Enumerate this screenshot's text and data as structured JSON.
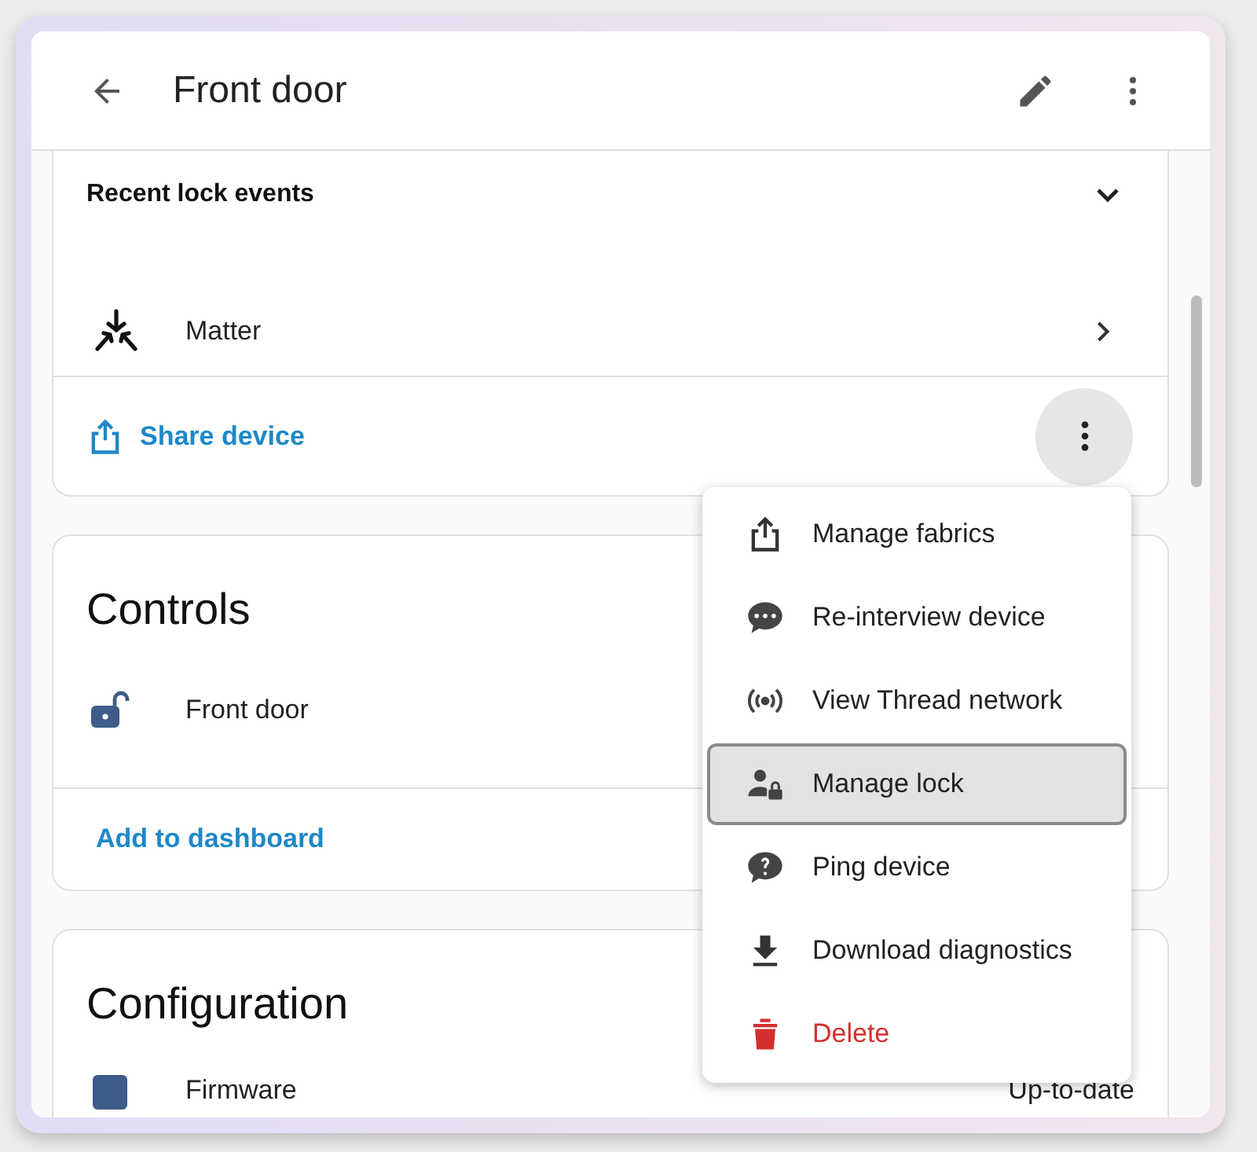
{
  "header": {
    "title": "Front door"
  },
  "info_card": {
    "section_title": "Recent lock events",
    "integration": "Matter",
    "share_link": "Share device"
  },
  "controls_card": {
    "title": "Controls",
    "entity": "Front door",
    "link": "Add to dashboard"
  },
  "configuration_card": {
    "title": "Configuration",
    "row_label": "Firmware",
    "row_value": "Up-to-date"
  },
  "menu": [
    {
      "label": "Manage fabrics",
      "kind": "normal",
      "selected": false
    },
    {
      "label": "Re-interview device",
      "kind": "normal",
      "selected": false
    },
    {
      "label": "View Thread network",
      "kind": "normal",
      "selected": false
    },
    {
      "label": "Manage lock",
      "kind": "normal",
      "selected": true
    },
    {
      "label": "Ping device",
      "kind": "normal",
      "selected": false
    },
    {
      "label": "Download diagnostics",
      "kind": "normal",
      "selected": false
    },
    {
      "label": "Delete",
      "kind": "danger",
      "selected": false
    }
  ]
}
